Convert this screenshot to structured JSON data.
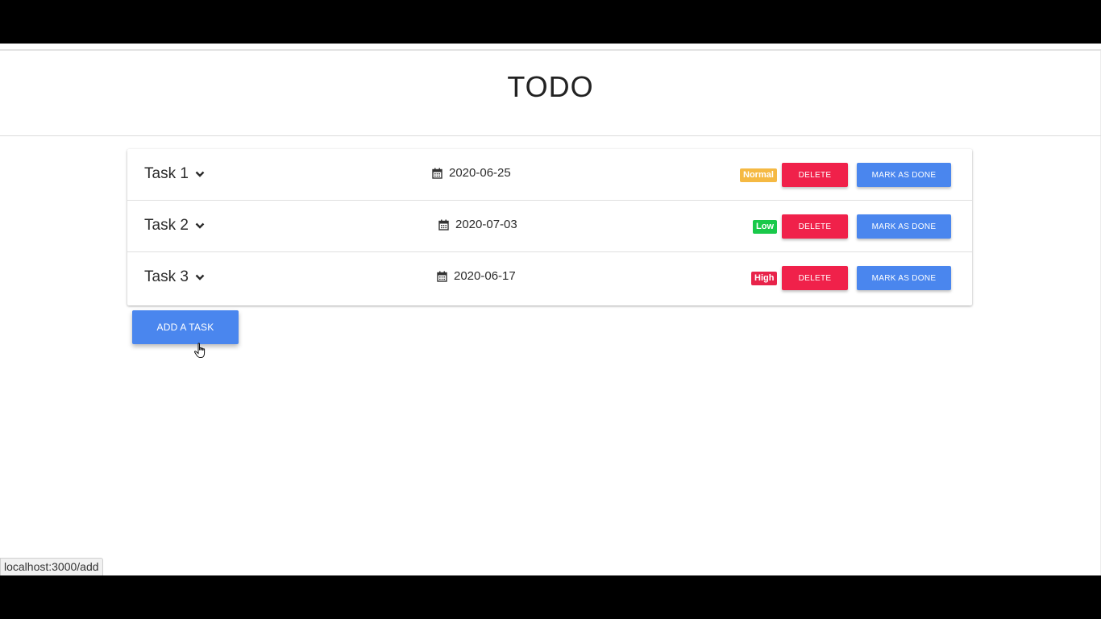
{
  "app": {
    "title": "TODO"
  },
  "tasks": [
    {
      "name": "Task 1",
      "date": "2020-06-25",
      "priority": "Normal",
      "priority_color": "#f5b943"
    },
    {
      "name": "Task 2",
      "date": "2020-07-03",
      "priority": "Low",
      "priority_color": "#19c94a"
    },
    {
      "name": "Task 3",
      "date": "2020-06-17",
      "priority": "High",
      "priority_color": "#e8234a"
    }
  ],
  "actions": {
    "delete_label": "DELETE",
    "done_label": "MARK AS DONE",
    "add_label": "ADD A TASK"
  },
  "statusbar": {
    "url": "localhost:3000/add"
  },
  "colors": {
    "primary": "#4a86ee",
    "danger": "#f0214a"
  }
}
